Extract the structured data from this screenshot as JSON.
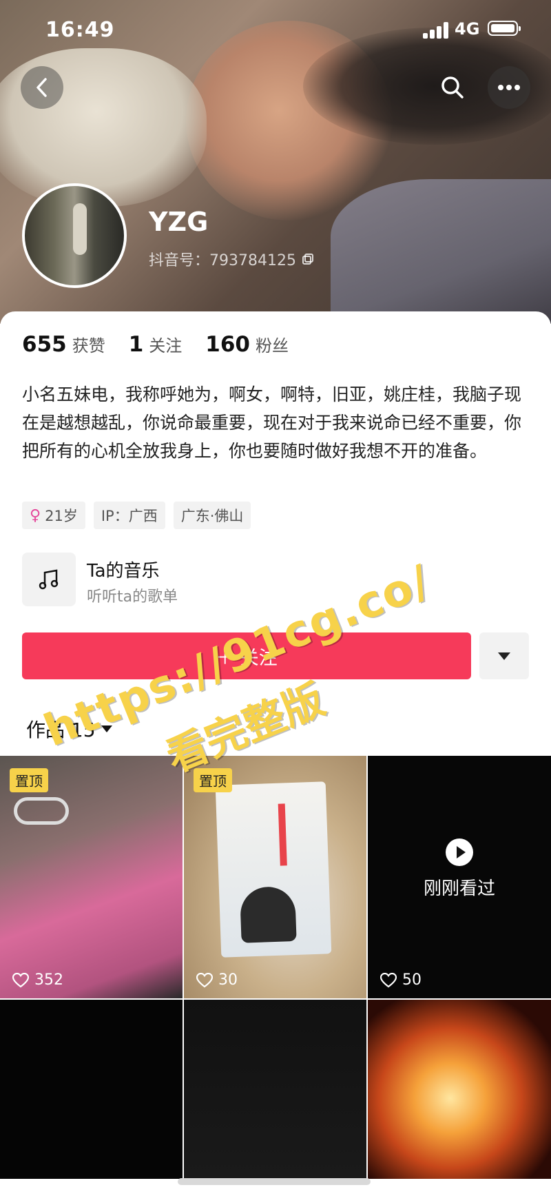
{
  "status_bar": {
    "time": "16:49",
    "network": "4G"
  },
  "profile": {
    "username": "YZG",
    "douyin_id": "抖音号：793784125"
  },
  "stats": [
    {
      "value": "655",
      "label": "获赞"
    },
    {
      "value": "1",
      "label": "关注"
    },
    {
      "value": "160",
      "label": "粉丝"
    }
  ],
  "bio": "小名五妹电，我称呼她为，啊女，啊特，旧亚，姚庄桂，我脑子现在是越想越乱，你说命最重要，现在对于我来说命已经不重要，你把所有的心机全放我身上，你也要随时做好我想不开的准备。",
  "tags": {
    "age": "21岁",
    "ip": "IP：广西",
    "location": "广东·佛山"
  },
  "music": {
    "title": "Ta的音乐",
    "subtitle": "听听ta的歌单"
  },
  "follow_button": {
    "label": "＋ 关注"
  },
  "works_tab": {
    "label": "作品 15"
  },
  "grid": [
    {
      "pinned": "置顶",
      "likes": "352"
    },
    {
      "pinned": "置顶",
      "likes": "30"
    },
    {
      "overlay": "刚刚看过",
      "likes": "50"
    },
    {},
    {},
    {}
  ],
  "watermark": {
    "line1": "https://91cg.co/",
    "line2": "看完整版"
  },
  "colors": {
    "follow": "#f63a5a",
    "pin_badge": "#f7d24a",
    "female": "#e5479b"
  }
}
